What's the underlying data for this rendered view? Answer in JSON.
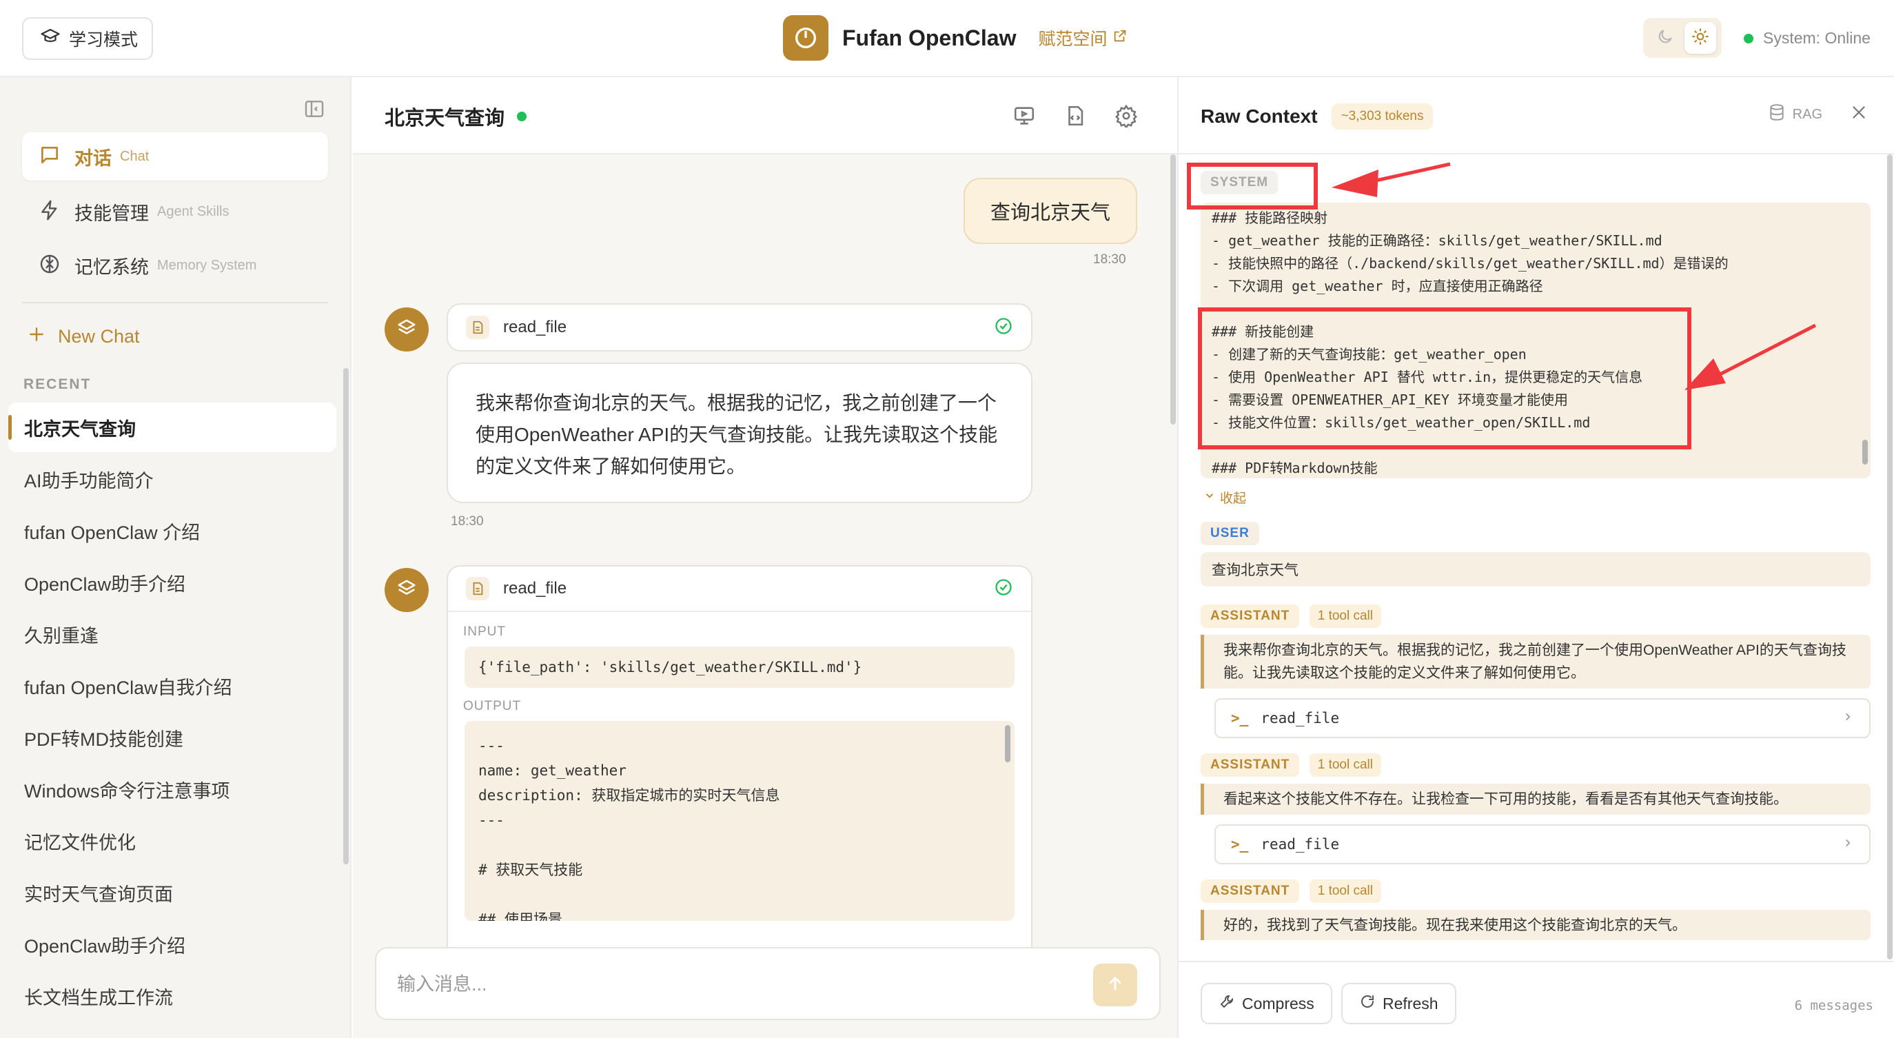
{
  "header": {
    "mode_button": "学习模式",
    "brand_name": "Fufan OpenClaw",
    "brand_link": "赋范空间",
    "status": "System: Online"
  },
  "sidebar": {
    "nav": [
      {
        "zh": "对话",
        "en": "Chat",
        "icon": "chat-bubble-icon"
      },
      {
        "zh": "技能管理",
        "en": "Agent Skills",
        "icon": "lightning-icon"
      },
      {
        "zh": "记忆系统",
        "en": "Memory System",
        "icon": "brain-icon"
      }
    ],
    "new_chat": "New Chat",
    "recent_label": "RECENT",
    "history": [
      "北京天气查询",
      "AI助手功能简介",
      "fufan OpenClaw 介绍",
      "OpenClaw助手介绍",
      "久别重逢",
      "fufan OpenClaw自我介绍",
      "PDF转MD技能创建",
      "Windows命令行注意事项",
      "记忆文件优化",
      "实时天气查询页面",
      "OpenClaw助手介绍",
      "长文档生成工作流"
    ]
  },
  "chat": {
    "title": "北京天气查询",
    "user_message": "查询北京天气",
    "user_time": "18:30",
    "tool1": {
      "name": "read_file"
    },
    "assistant_message": "我来帮你查询北京的天气。根据我的记忆，我之前创建了一个使用OpenWeather API的天气查询技能。让我先读取这个技能的定义文件来了解如何使用它。",
    "assistant_time": "18:30",
    "tool2": {
      "name": "read_file",
      "input_label": "INPUT",
      "input": "{'file_path': 'skills/get_weather/SKILL.md'}",
      "output_label": "OUTPUT",
      "output_lines": [
        "---",
        "name: get_weather",
        "description: 获取指定城市的实时天气信息",
        "---",
        "",
        "# 获取天气技能",
        "",
        "## 使用场景"
      ]
    },
    "input_placeholder": "输入消息..."
  },
  "raw_context": {
    "title": "Raw Context",
    "tokens": "~3,303 tokens",
    "rag_label": "RAG",
    "system_label": "SYSTEM",
    "system_lines": [
      "### 技能路径映射",
      "- get_weather 技能的正确路径：skills/get_weather/SKILL.md",
      "- 技能快照中的路径（./backend/skills/get_weather/SKILL.md）是错误的",
      "- 下次调用 get_weather 时，应直接使用正确路径",
      "",
      "### 新技能创建",
      "- 创建了新的天气查询技能：get_weather_open",
      "- 使用 OpenWeather API 替代 wttr.in，提供更稳定的天气信息",
      "- 需要设置 OPENWEATHER_API_KEY 环境变量才能使用",
      "- 技能文件位置：skills/get_weather_open/SKILL.md",
      "",
      "### PDF转Markdown技能"
    ],
    "collapse_label": "收起",
    "user_label": "USER",
    "user_text": "查询北京天气",
    "assistant_label": "ASSISTANT",
    "toolcall_label": "1 tool call",
    "assistant_msgs": [
      {
        "text": "我来帮你查询北京的天气。根据我的记忆，我之前创建了一个使用OpenWeather API的天气查询技能。让我先读取这个技能的定义文件来了解如何使用它。",
        "tool": "read_file"
      },
      {
        "text": "看起来这个技能文件不存在。让我检查一下可用的技能，看看是否有其他天气查询技能。",
        "tool": "read_file"
      },
      {
        "text": "好的，我找到了天气查询技能。现在我来使用这个技能查询北京的天气。"
      }
    ],
    "compress_label": "Compress",
    "refresh_label": "Refresh",
    "message_count": "6 messages"
  },
  "colors": {
    "accent": "#b8862e",
    "accent_light": "#fbf1dd",
    "online": "#1fbe58",
    "annotation": "#ee3a3f"
  }
}
